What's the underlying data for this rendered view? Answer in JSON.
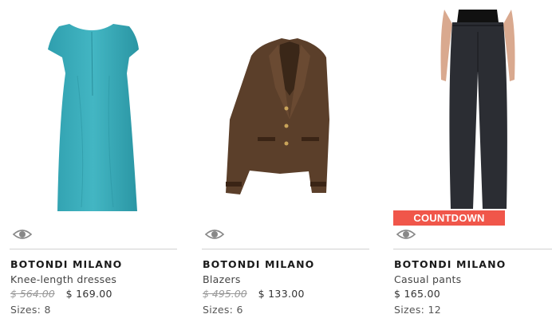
{
  "products": [
    {
      "brand": "BOTONDI MILANO",
      "category": "Knee-length dresses",
      "old_price": "$ 564.00",
      "price": "$ 169.00",
      "sizes": "Sizes:  8",
      "image": "teal-dress",
      "quick_view_icon": "eye-icon"
    },
    {
      "brand": "BOTONDI MILANO",
      "category": "Blazers",
      "old_price": "$ 495.00",
      "price": "$ 133.00",
      "sizes": "Sizes:  6",
      "image": "brown-blazer",
      "quick_view_icon": "eye-icon"
    },
    {
      "brand": "BOTONDI MILANO",
      "category": "Casual pants",
      "price": "$ 165.00",
      "sizes": "Sizes:  12",
      "badge": "COUNTDOWN",
      "image": "dark-wide-pants",
      "quick_view_icon": "eye-icon"
    }
  ],
  "colors": {
    "badge": "#f0564a",
    "old_price": "#999999",
    "divider": "#d0d0d0"
  }
}
